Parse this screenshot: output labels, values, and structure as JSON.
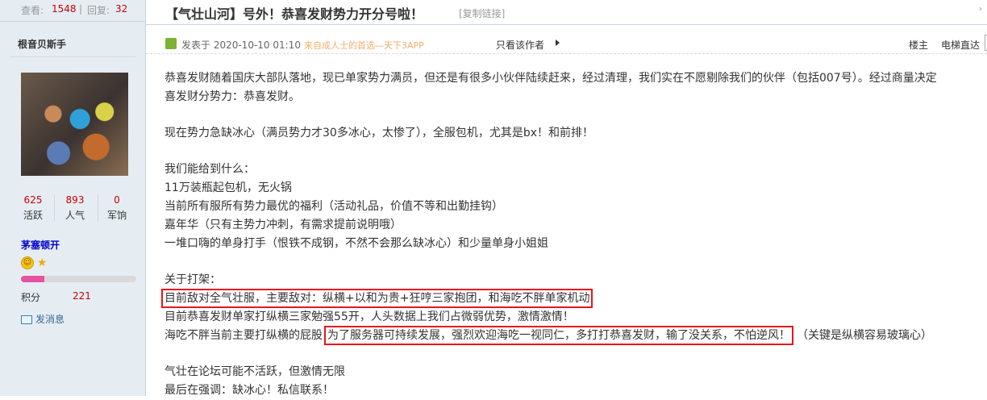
{
  "stats": {
    "views_label": "查看:",
    "views": "1548",
    "sep": "|",
    "replies_label": "回复:",
    "replies": "32"
  },
  "author": {
    "name": "根音贝斯手",
    "stats": [
      {
        "value": "625",
        "label": "活跃"
      },
      {
        "value": "893",
        "label": "人气"
      },
      {
        "value": "0",
        "label": "军饷"
      }
    ],
    "group": "茅塞顿开",
    "level_progress": 0.2,
    "points_label": "积分",
    "points": "221",
    "message": "发消息"
  },
  "post": {
    "title": "【气壮山河】号外！恭喜发财势力开分号啦！",
    "copy_link": "[复制链接]",
    "posted": "发表于 2020-10-10 01:10",
    "source": "来自成人士的首选—天下3APP",
    "only_author": "只看该作者",
    "floor": "楼主",
    "elevator": "电梯直达",
    "lines": [
      "恭喜发财随着国庆大部队落地，现已单家势力满员，但还是有很多小伙伴陆续赶来，经过清理，我们实在不愿剔除我们的伙伴（包括007号）。经过商量决定",
      "喜发财分势力：恭喜发财。",
      "",
      "现在势力急缺冰心（满员势力才30多冰心，太惨了），全服包机，尤其是bx！和前排！",
      "",
      "我们能给到什么：",
      "11万装瓶起包机，无火锅",
      "当前所有服所有势力最优的福利（活动礼品，价值不等和出勤挂钩）",
      "嘉年华（只有主势力冲刺，有需求提前说明哦）",
      "一堆口嗨的单身打手（恨铁不成钢，不然不会那么缺冰心）和少量单身小姐姐",
      "",
      "关于打架：",
      "目前敌对全气壮服，主要敌对：纵横+以和为贵+狂哼三家抱团，和海吃不胖单家机动",
      "目前恭喜发财单家打纵横三家勉强55开，人头数据上我们占微弱优势，激情激情！",
      "海吃不胖当前主要打纵横的屁股",
      "为了服务器可持续发展，强烈欢迎海吃一视同仁，多打打恭喜发财，输了没关系，不怕逆风！",
      "（关键是纵横容易玻璃心）",
      "",
      "气壮在论坛可能不活跃，但激情无限",
      "最后在强调：缺冰心！私信联系！"
    ]
  },
  "colors": {
    "highlight": "#e8141b",
    "link": "#369",
    "accent_red": "#cc0000",
    "sidebar_bg": "#e5edf2"
  }
}
